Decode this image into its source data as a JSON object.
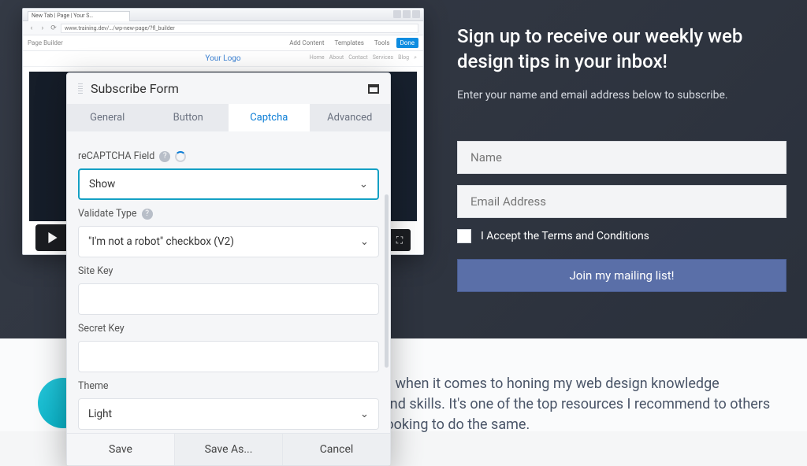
{
  "hero": {
    "heading": "Sign up to receive our weekly web design tips in your inbox!",
    "sub": "Enter your name and email address below to subscribe.",
    "name_placeholder": "Name",
    "email_placeholder": "Email Address",
    "terms_label": "I Accept the Terms and Conditions",
    "button_label": "Join my mailing list!"
  },
  "testimonial": {
    "line1": "… when it comes to honing my web design knowledge",
    "line2": "and skills. It's one of the top resources I recommend to others looking to do the same."
  },
  "browser": {
    "tab_title": "New Tab | Page | Your S…",
    "url": "www.training.dev/…/wp-new-page/?fl_builder",
    "page_builder": "Page Builder",
    "chips": [
      "Add Content",
      "Templates",
      "Tools",
      "Done"
    ],
    "logo": "Your Logo",
    "mini_nav": [
      "Home",
      "About",
      "Contact",
      "Services",
      "Blog"
    ]
  },
  "panel": {
    "title": "Subscribe Form",
    "tabs": [
      "General",
      "Button",
      "Captcha",
      "Advanced"
    ],
    "active_tab": 2,
    "fields": {
      "recaptcha_label": "reCAPTCHA Field",
      "recaptcha_value": "Show",
      "validate_label": "Validate Type",
      "validate_value": "\"I'm not a robot\" checkbox (V2)",
      "sitekey_label": "Site Key",
      "sitekey_value": "",
      "secret_label": "Secret Key",
      "secret_value": "",
      "theme_label": "Theme",
      "theme_value": "Light"
    },
    "buttons": {
      "save": "Save",
      "saveas": "Save As...",
      "cancel": "Cancel"
    }
  }
}
